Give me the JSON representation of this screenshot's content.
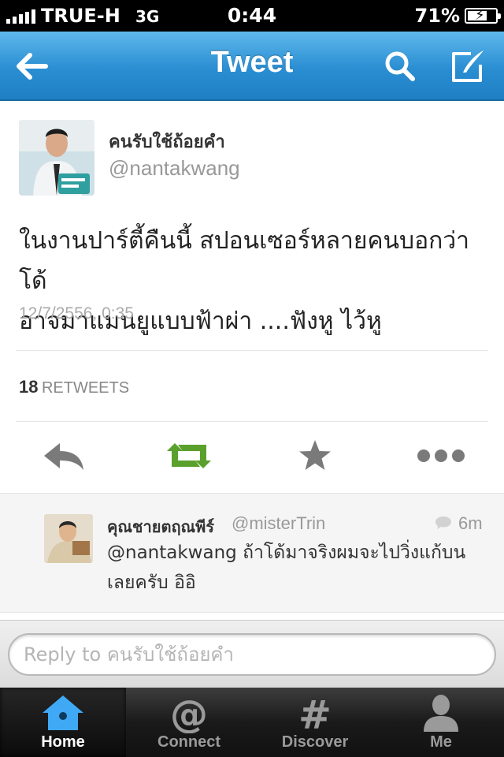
{
  "status_bar": {
    "carrier": "TRUE-H",
    "network": "3G",
    "time": "0:44",
    "battery": "71%",
    "battery_level": 0.71
  },
  "nav": {
    "title": "Tweet",
    "left_icon": "back-arrow-icon",
    "right_icons": [
      "search-icon",
      "compose-icon"
    ]
  },
  "tweet": {
    "author_name": "คนรับใช้ถ้อยคำ",
    "author_handle": "@nantakwang",
    "text_line1": "ในงานปาร์ตี้คืนนี้ สปอนเซอร์หลายคนบอกว่า โด้",
    "text_line2": "อาจมาแมนยูแบบฟ้าผ่า ....ฟังหู ไว้หู",
    "timestamp": "12/7/2556, 0:35",
    "retweet_count": "18",
    "retweet_label": "RETWEETS",
    "actions": [
      "reply-icon",
      "retweet-icon",
      "favorite-icon",
      "more-icon"
    ],
    "colors": {
      "retweet": "#5aa02c",
      "action_gray": "#7a7a7a"
    }
  },
  "reply": {
    "author_name": "คุณชายตฤณพีร์",
    "author_handle": "@misterTrin",
    "age": "6m",
    "text_line1": "@nantakwang ถ้าโด้มาจริงผมจะไปวิ่งแก้บน",
    "text_line2": "เลยครับ อิอิ"
  },
  "composer": {
    "placeholder": "Reply to คนรับใช้ถ้อยคำ",
    "value": ""
  },
  "tabs": [
    {
      "label": "Home",
      "icon": "home-icon",
      "active": true
    },
    {
      "label": "Connect",
      "icon": "at-icon",
      "active": false
    },
    {
      "label": "Discover",
      "icon": "hash-icon",
      "active": false
    },
    {
      "label": "Me",
      "icon": "person-icon",
      "active": false
    }
  ],
  "colors": {
    "nav_blue": "#2a8ed2",
    "active_tab_icon": "#3fa9f5",
    "tab_text_active": "#ffffff",
    "tab_text_inactive": "#9a9a9a"
  }
}
